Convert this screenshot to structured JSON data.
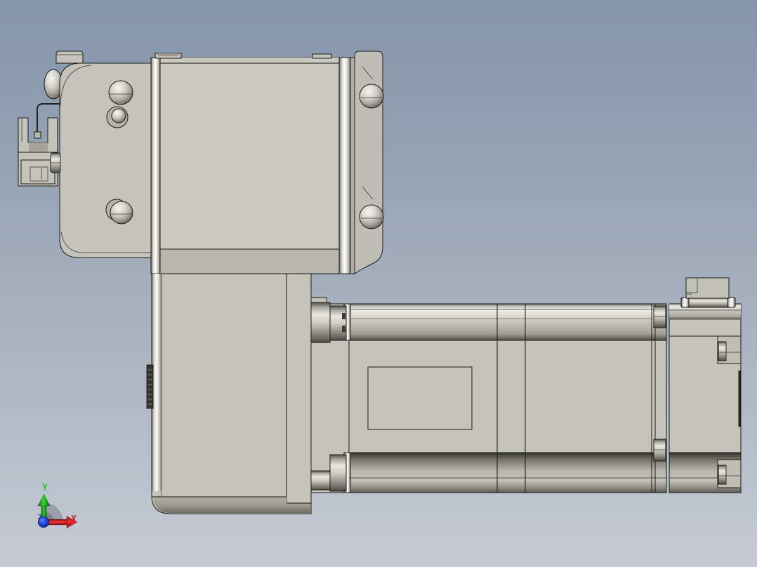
{
  "viewport": {
    "background_top": "#8595ab",
    "background_bottom": "#c6cbd4",
    "model_base_color": "#c5c4bb",
    "outline_color": "#1b1b18"
  },
  "triad": {
    "labels": {
      "x": "X",
      "y": "Y",
      "z": "Z"
    },
    "colors": {
      "x": "#cc2222",
      "y": "#22cc22",
      "z": "#1537b8",
      "arc": "#9aa0ab"
    }
  },
  "model": {
    "parts": [
      "sensor-bracket",
      "sensor-cable",
      "carriage-plate",
      "carriage-block",
      "button-head-screws",
      "right-flange-plate",
      "actuator-vertical-body",
      "actuator-tube",
      "tube-label-plate",
      "shaft-nuts",
      "clamp-ring",
      "motor-housing",
      "motor-connector"
    ]
  }
}
